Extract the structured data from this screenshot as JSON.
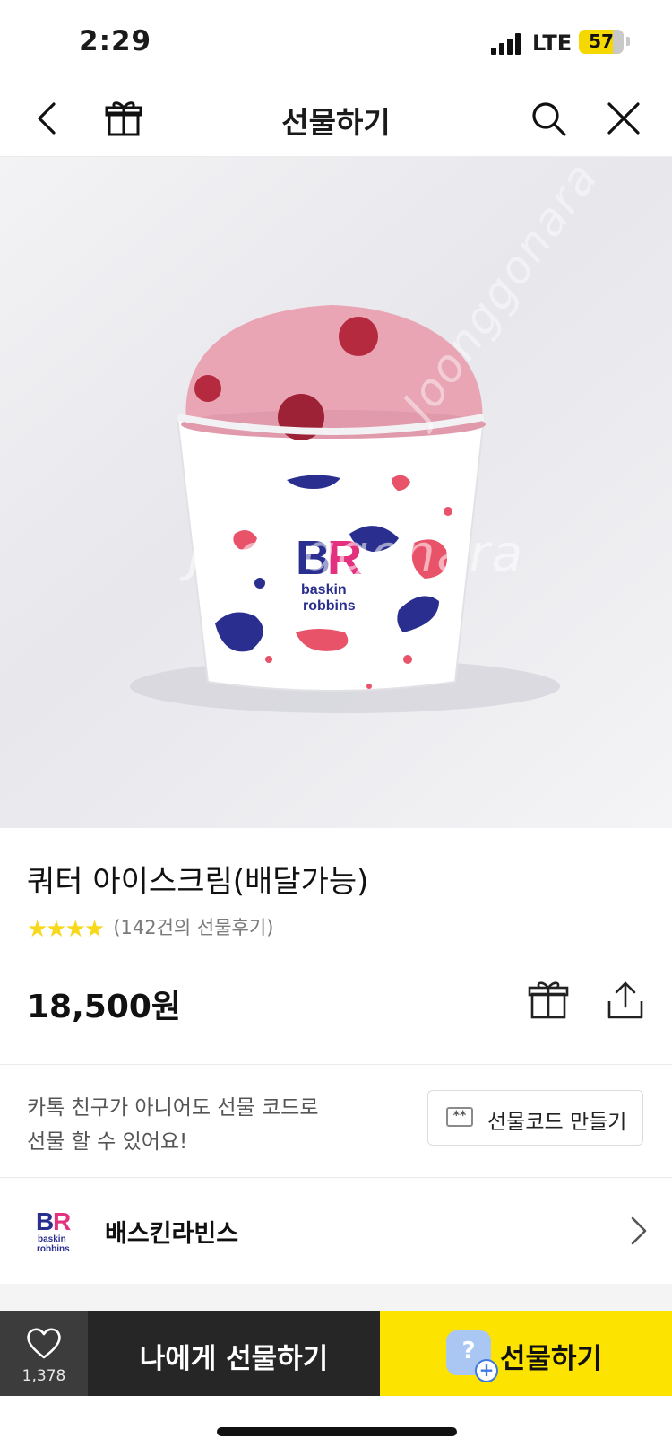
{
  "status_bar": {
    "time": "2:29",
    "network": "LTE",
    "battery": "57"
  },
  "nav": {
    "title": "선물하기"
  },
  "hero": {
    "watermark": "Joonggonara"
  },
  "product": {
    "title": "쿼터 아이스크림(배달가능)",
    "rating_stars": "★★★★",
    "review_text": "(142건의 선물후기)",
    "price": "18,500원"
  },
  "gift_code": {
    "description_line1": "카톡 친구가 아니어도 선물 코드로",
    "description_line2": "선물 할 수 있어요!",
    "button_label": "선물코드 만들기",
    "button_icon_text": "**"
  },
  "brand": {
    "name": "배스킨라빈스",
    "logo_text": "BR"
  },
  "bottom_bar": {
    "like_count": "1,378",
    "self_gift_label": "나에게 선물하기",
    "gift_label": "선물하기",
    "gift_badge_text": "?",
    "gift_badge_plus": "+"
  },
  "colors": {
    "accent_yellow": "#fde400",
    "dark_button": "#262626",
    "like_button": "#3c3c3c",
    "br_pink": "#e4317f",
    "br_blue": "#2a2f8f"
  },
  "icons": [
    "back-icon",
    "gift-box-icon",
    "search-icon",
    "close-icon",
    "share-icon",
    "heart-icon",
    "chevron-right-icon",
    "gift-code-icon"
  ]
}
